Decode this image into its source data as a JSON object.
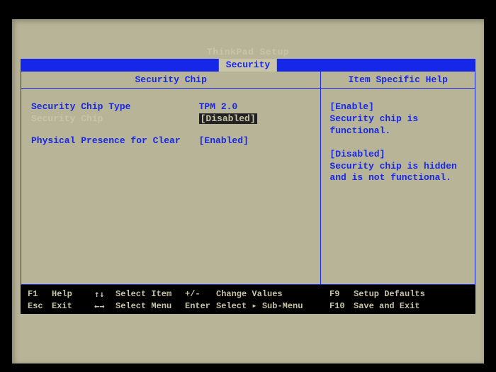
{
  "title": "ThinkPad Setup",
  "active_tab": "Security",
  "left_pane_header": "Security Chip",
  "right_pane_header": "Item Specific Help",
  "settings": [
    {
      "label": "Security Chip Type",
      "value": "TPM 2.0",
      "selected": false,
      "bracketed": false
    },
    {
      "label": "Security Chip",
      "value": "Disabled",
      "selected": true,
      "bracketed": true
    },
    {
      "label": "Physical Presence for Clear",
      "value": "Enabled",
      "selected": false,
      "bracketed": true,
      "spacer_before": true
    }
  ],
  "help": {
    "sections": [
      {
        "heading": "[Enable]",
        "body": "Security chip is functional."
      },
      {
        "heading": "[Disabled]",
        "body": "Security chip is hidden and is not functional."
      }
    ]
  },
  "footer": {
    "r1": {
      "k1": "F1",
      "d1": "Help",
      "k2": "↑↓",
      "d2": "Select Item",
      "k3": "+/-",
      "d3": "Change Values",
      "k4": "F9",
      "d4": "Setup Defaults"
    },
    "r2": {
      "k1": "Esc",
      "d1": "Exit",
      "k2": "←→",
      "d2": "Select Menu",
      "k3": "Enter",
      "d3": "Select ▸ Sub-Menu",
      "k4": "F10",
      "d4": "Save and Exit"
    }
  }
}
